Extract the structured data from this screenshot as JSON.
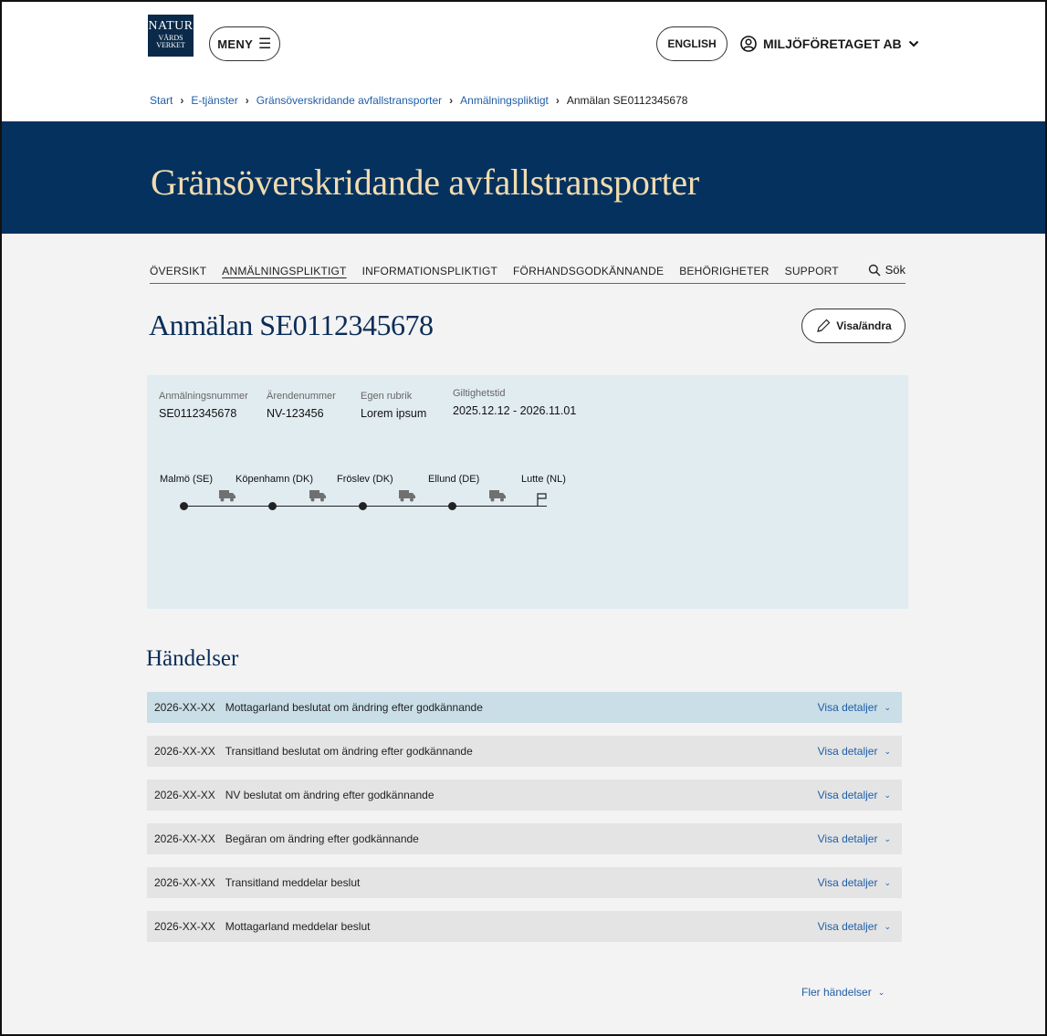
{
  "header": {
    "logo": {
      "line1": "NATUR",
      "line2": "VÅRDS",
      "line3": "VERKET"
    },
    "menu_label": "MENY",
    "language_label": "ENGLISH",
    "account_label": "MILJÖFÖRETAGET AB"
  },
  "breadcrumb": {
    "items": [
      "Start",
      "E-tjänster",
      "Gränsöverskridande avfallstransporter",
      "Anmälningspliktigt"
    ],
    "current": "Anmälan SE0112345678"
  },
  "hero": {
    "title": "Gränsöverskridande avfallstransporter"
  },
  "tabs": {
    "items": [
      "ÖVERSIKT",
      "ANMÄLNINGSPLIKTIGT",
      "INFORMATIONSPLIKTIGT",
      "FÖRHANDSGODKÄNNANDE",
      "BEHÖRIGHETER",
      "SUPPORT"
    ],
    "active": "ANMÄLNINGSPLIKTIGT",
    "search_label": "Sök"
  },
  "page": {
    "title": "Anmälan SE0112345678",
    "edit_label": "Visa/ändra"
  },
  "info": {
    "fields": [
      {
        "label": "Anmälningsnummer",
        "value": "SE0112345678"
      },
      {
        "label": "Ärendenummer",
        "value": "NV-123456"
      },
      {
        "label": "Egen rubrik",
        "value": "Lorem ipsum"
      },
      {
        "label": "Giltighetstid",
        "value": "2025.12.12 - 2026.11.01"
      }
    ],
    "route_stops": [
      "Malmö (SE)",
      "Köpenhamn (DK)",
      "Fröslev (DK)",
      "Ellund (DE)",
      "Lutte (NL)"
    ]
  },
  "events": {
    "title": "Händelser",
    "details_label": "Visa detaljer",
    "more_label": "Fler händelser",
    "items": [
      {
        "date": "2026-XX-XX",
        "text": "Mottagarland beslutat om ändring efter godkännande"
      },
      {
        "date": "2026-XX-XX",
        "text": "Transitland beslutat om ändring efter godkännande"
      },
      {
        "date": "2026-XX-XX",
        "text": "NV beslutat om ändring efter godkännande"
      },
      {
        "date": "2026-XX-XX",
        "text": "Begäran om ändring efter godkännande"
      },
      {
        "date": "2026-XX-XX",
        "text": "Transitland meddelar beslut"
      },
      {
        "date": "2026-XX-XX",
        "text": "Mottagarland meddelar beslut"
      }
    ]
  },
  "colors": {
    "hero_bg": "#05315f",
    "hero_text": "#f1dcae",
    "link": "#1f5ea8",
    "panel_bg": "#e1ecf1",
    "highlight_row": "#c9dee6"
  },
  "icons": {
    "menu": "hamburger-icon",
    "account": "user-circle-icon",
    "account_chevron": "chevron-down-icon",
    "search": "search-icon",
    "edit": "pencil-icon",
    "truck": "truck-icon",
    "flag": "flag-icon",
    "details": "chevron-down-icon"
  }
}
